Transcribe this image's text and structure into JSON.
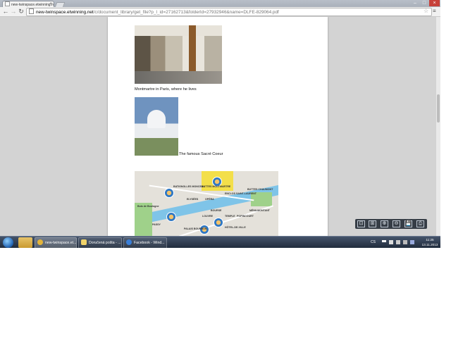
{
  "browser": {
    "tab_title": "new-twinspace.etwinning.n",
    "tab_close": "×",
    "window_min": "–",
    "window_max": "□",
    "window_close": "×",
    "back": "←",
    "forward": "→",
    "reload": "↻",
    "url_host": "new-twinspace.etwinning.net",
    "url_path": "/c/document_library/get_file?p_l_id=27162713&folderId=27932946&name=DLFE-829064.pdf",
    "star": "☆",
    "menu": "≡"
  },
  "document": {
    "caption_street": "Montmartre in Paris, where he lives",
    "caption_sacre": "The famous Sacré Coeur",
    "map_labels": [
      "BATIGNOLLES MONCEAU",
      "BUTTES MONTMARTRE",
      "ENCLOS SAINT-LAURENT",
      "BUTTES CHAUMONT",
      "ELYSÉES",
      "OPÉRA",
      "Bois de Boulogne",
      "MÉNILMONTANT",
      "BOURSE",
      "TEMPLE",
      "POPINCOURT",
      "LOUVRE",
      "PASSY",
      "HÔTEL-DE-VILLE",
      "PALAIS BOURBON"
    ]
  },
  "pdf_controls": [
    "⊡",
    "⊞",
    "⊕",
    "⊖",
    "💾",
    "⎙"
  ],
  "taskbar": {
    "tasks": [
      {
        "label": "new-twinspace.et...",
        "active": true,
        "color": "#e3b43a"
      },
      {
        "label": "Doručená pošta - ...",
        "active": false,
        "color": "#f0d36a"
      },
      {
        "label": "Facebook - Wind...",
        "active": false,
        "color": "#3a7fd8"
      }
    ],
    "language": "CS",
    "time": "11:25",
    "date": "13.11.2013"
  }
}
